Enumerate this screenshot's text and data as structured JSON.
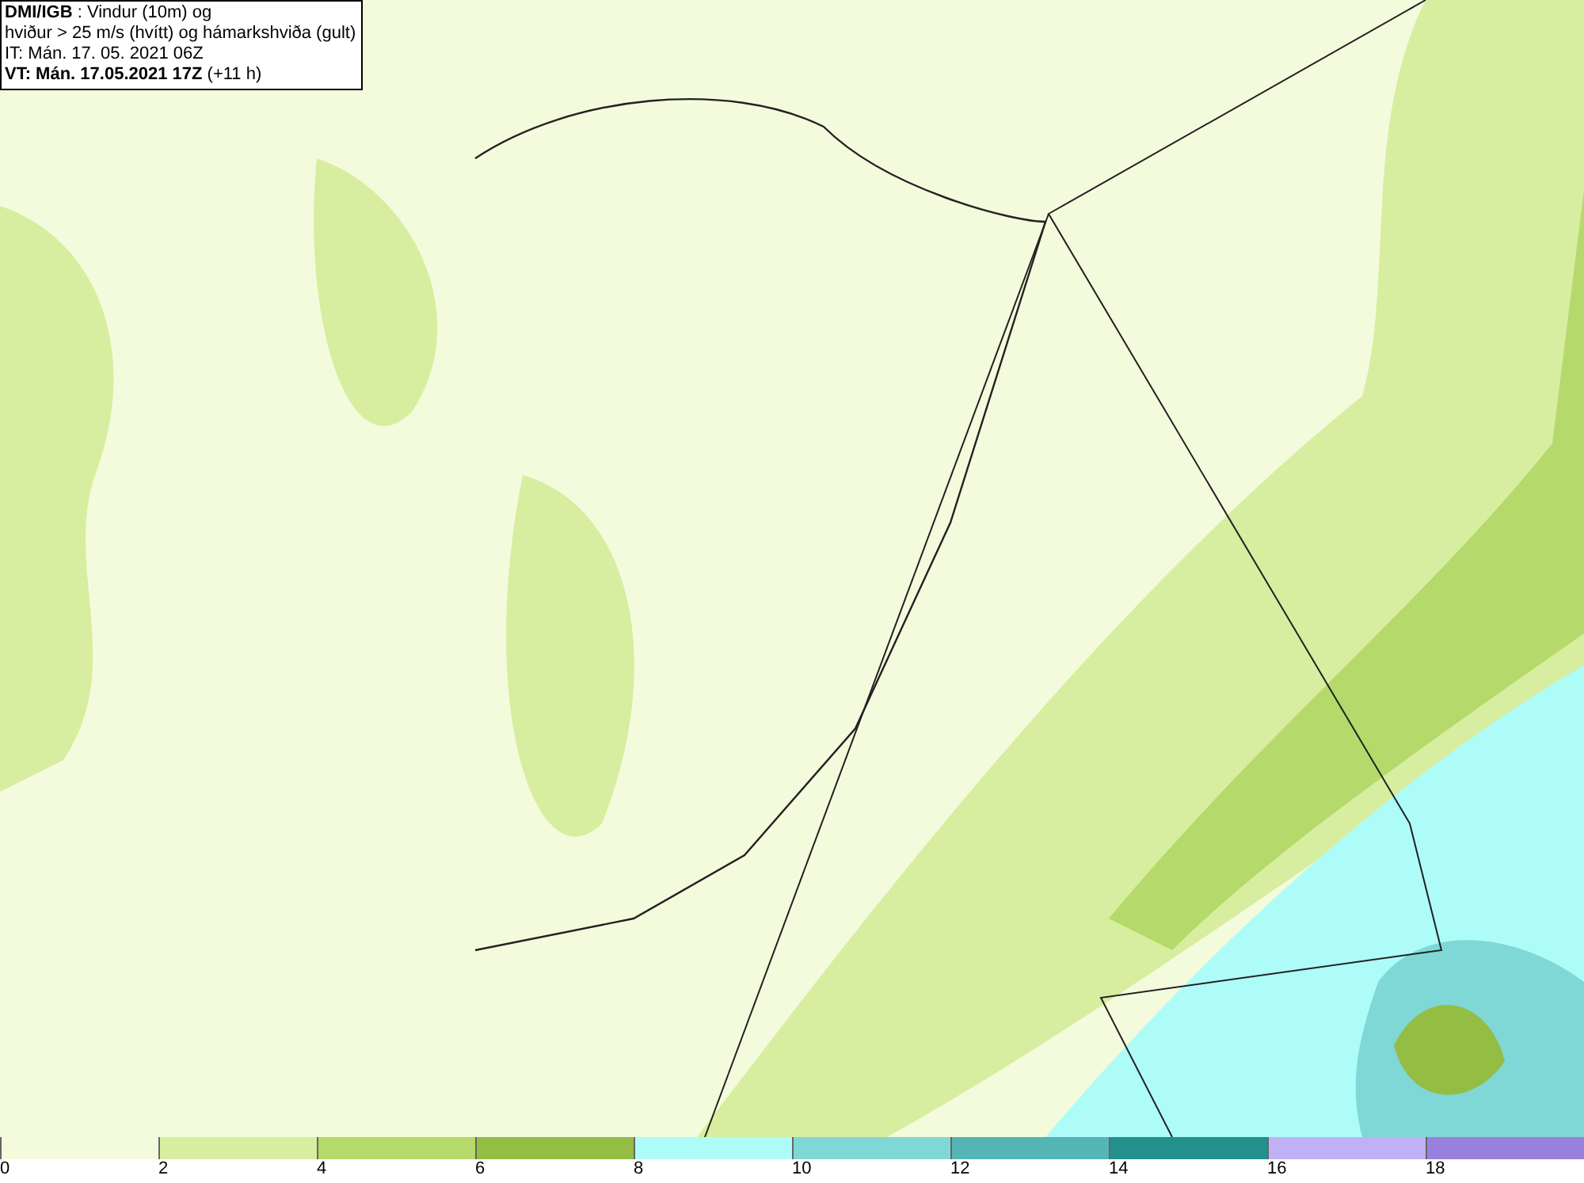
{
  "info_box": {
    "lines": [
      "**DMI/IGB** : Vindur (10m) og",
      "hviður > 25 m/s (hvítt) og hámarkshviða (gult)",
      "IT: Mán. 17. 05. 2021 06Z",
      "**VT: Mán. 17.05.2021 17Z** (+11 h)"
    ]
  },
  "legend": [
    {
      "label": "0",
      "color": "#f4fbdc"
    },
    {
      "label": "2",
      "color": "#d7eea0"
    },
    {
      "label": "4",
      "color": "#b5d96a"
    },
    {
      "label": "6",
      "color": "#94bd44"
    },
    {
      "label": "8",
      "color": "#aefcf8"
    },
    {
      "label": "10",
      "color": "#7fd8d6"
    },
    {
      "label": "12",
      "color": "#55b5b5"
    },
    {
      "label": "14",
      "color": "#23908e"
    },
    {
      "label": "16",
      "color": "#c0b0f6"
    },
    {
      "label": "18",
      "color": "#9a80dd"
    }
  ]
}
